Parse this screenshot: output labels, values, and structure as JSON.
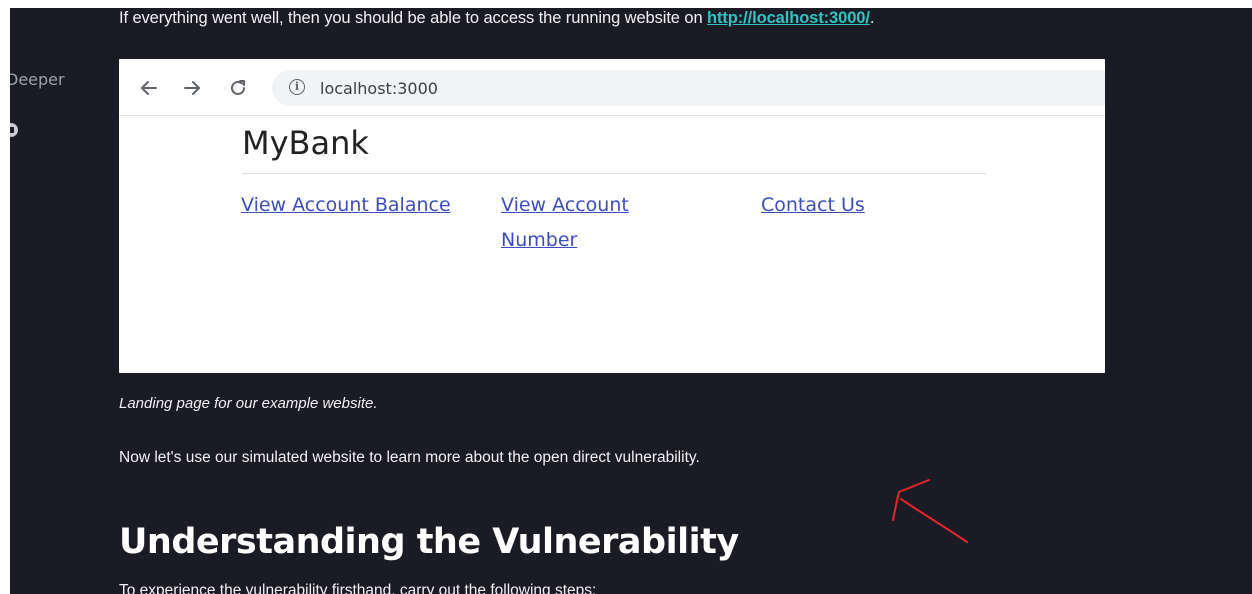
{
  "sidebar": {
    "item_label": "Deeper",
    "icon": "circle-badge-icon"
  },
  "article": {
    "intro_text": "If everything went well, then you should be able to access the running website on ",
    "intro_link": "http://localhost:3000/",
    "intro_end": ".",
    "caption": "Landing page for our example website.",
    "paragraph": "Now let's use our simulated website to learn more about the open direct vulnerability.",
    "heading": "Understanding the Vulnerability",
    "steps_intro": "To experience the vulnerability firsthand, carry out the following steps:"
  },
  "browser": {
    "url": "localhost:3000",
    "icons": [
      "back-arrow-icon",
      "forward-arrow-icon",
      "reload-icon",
      "info-icon"
    ],
    "site": {
      "title": "MyBank",
      "nav_links": [
        {
          "label": "View Account Balance"
        },
        {
          "label": "View Account Number"
        },
        {
          "label": "Contact Us"
        }
      ]
    }
  },
  "annotation": {
    "arrow_color": "#e3262b"
  },
  "colors": {
    "page_background": "#1b1b26",
    "link_accent": "#2ec4c1",
    "site_link": "#3b4ec0"
  }
}
